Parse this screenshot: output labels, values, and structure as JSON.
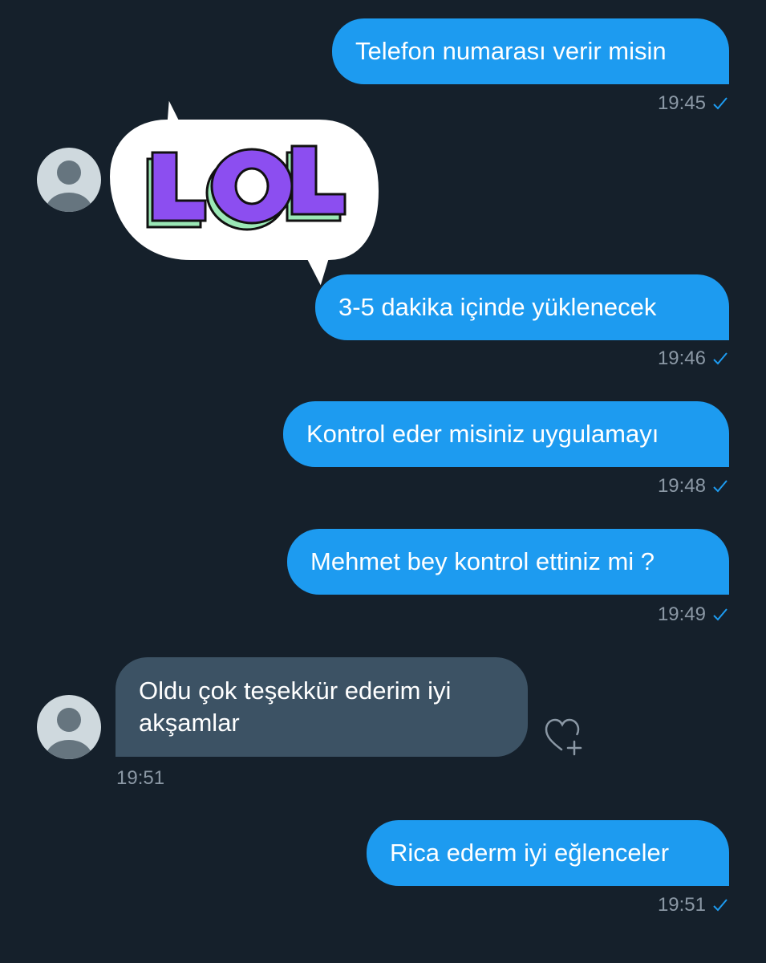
{
  "messages": [
    {
      "text": "Telefon numarası verir misin",
      "time": "19:45"
    },
    {
      "sticker_text": "LOL",
      "sticker_icon": "lol-sticker"
    },
    {
      "text": "3-5 dakika içinde yüklenecek",
      "time": "19:46"
    },
    {
      "text": "Kontrol eder misiniz uygulamayı",
      "time": "19:48"
    },
    {
      "text": "Mehmet bey kontrol ettiniz mi ?",
      "time": "19:49"
    },
    {
      "text": "Oldu çok teşekkür ederim iyi akşamlar",
      "time": "19:51"
    },
    {
      "text": "Rica ederm iyi eğlenceler",
      "time": "19:51"
    }
  ],
  "icons": {
    "read_receipt": "check-icon",
    "react": "heart-plus-icon",
    "avatar": "default-avatar-icon"
  },
  "colors": {
    "background": "#15202b",
    "outgoing_bubble": "#1d9bf0",
    "incoming_bubble": "#3c5264",
    "timestamp": "#8b98a5",
    "sticker_purple": "#8c4ef0",
    "sticker_green": "#9be8b6"
  }
}
